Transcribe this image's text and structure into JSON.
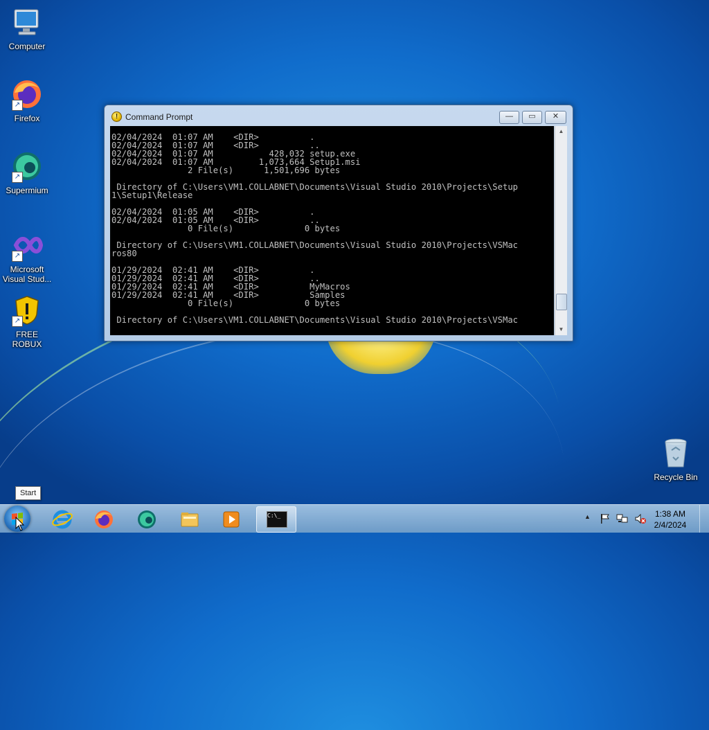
{
  "desktop": {
    "icons": [
      {
        "label": "Computer",
        "icon": "computer-icon"
      },
      {
        "label": "Firefox",
        "icon": "firefox-icon"
      },
      {
        "label": "Supermium",
        "icon": "supermium-icon"
      },
      {
        "label": "Microsoft Visual Stud...",
        "icon": "visual-studio-icon"
      },
      {
        "label": "FREE ROBUX",
        "icon": "shield-warning-icon"
      }
    ],
    "recycle_bin": "Recycle Bin"
  },
  "window": {
    "title": "Command Prompt",
    "controls": {
      "minimize": "—",
      "maximize": "▭",
      "close": "✕"
    },
    "console_text": "02/04/2024  01:07 AM    <DIR>          .\n02/04/2024  01:07 AM    <DIR>          ..\n02/04/2024  01:07 AM           428,032 setup.exe\n02/04/2024  01:07 AM         1,073,664 Setup1.msi\n               2 File(s)      1,501,696 bytes\n\n Directory of C:\\Users\\VM1.COLLABNET\\Documents\\Visual Studio 2010\\Projects\\Setup\n1\\Setup1\\Release\n\n02/04/2024  01:05 AM    <DIR>          .\n02/04/2024  01:05 AM    <DIR>          ..\n               0 File(s)              0 bytes\n\n Directory of C:\\Users\\VM1.COLLABNET\\Documents\\Visual Studio 2010\\Projects\\VSMac\nros80\n\n01/29/2024  02:41 AM    <DIR>          .\n01/29/2024  02:41 AM    <DIR>          ..\n01/29/2024  02:41 AM    <DIR>          MyMacros\n01/29/2024  02:41 AM    <DIR>          Samples\n               0 File(s)              0 bytes\n\n Directory of C:\\Users\\VM1.COLLABNET\\Documents\\Visual Studio 2010\\Projects\\VSMac",
    "scroll_position": 0.92
  },
  "tooltip": "Start",
  "taskbar": {
    "pinned": [
      {
        "name": "internet-explorer",
        "icon": "ie-icon"
      },
      {
        "name": "firefox",
        "icon": "firefox-icon"
      },
      {
        "name": "supermium",
        "icon": "supermium-icon"
      },
      {
        "name": "file-explorer",
        "icon": "folder-icon"
      },
      {
        "name": "media-player",
        "icon": "media-player-icon"
      },
      {
        "name": "command-prompt",
        "icon": "cmd-icon",
        "label": "C:\\_",
        "active": true
      }
    ],
    "tray": {
      "expand": "▲",
      "flag": "flag-icon",
      "network": "network-icon",
      "volume": "volume-muted-icon"
    },
    "time": "1:38 AM",
    "date": "2/4/2024"
  },
  "colors": {
    "desktop_blue": "#106ccb",
    "console_bg": "#000000",
    "console_fg": "#c0c0c0"
  }
}
